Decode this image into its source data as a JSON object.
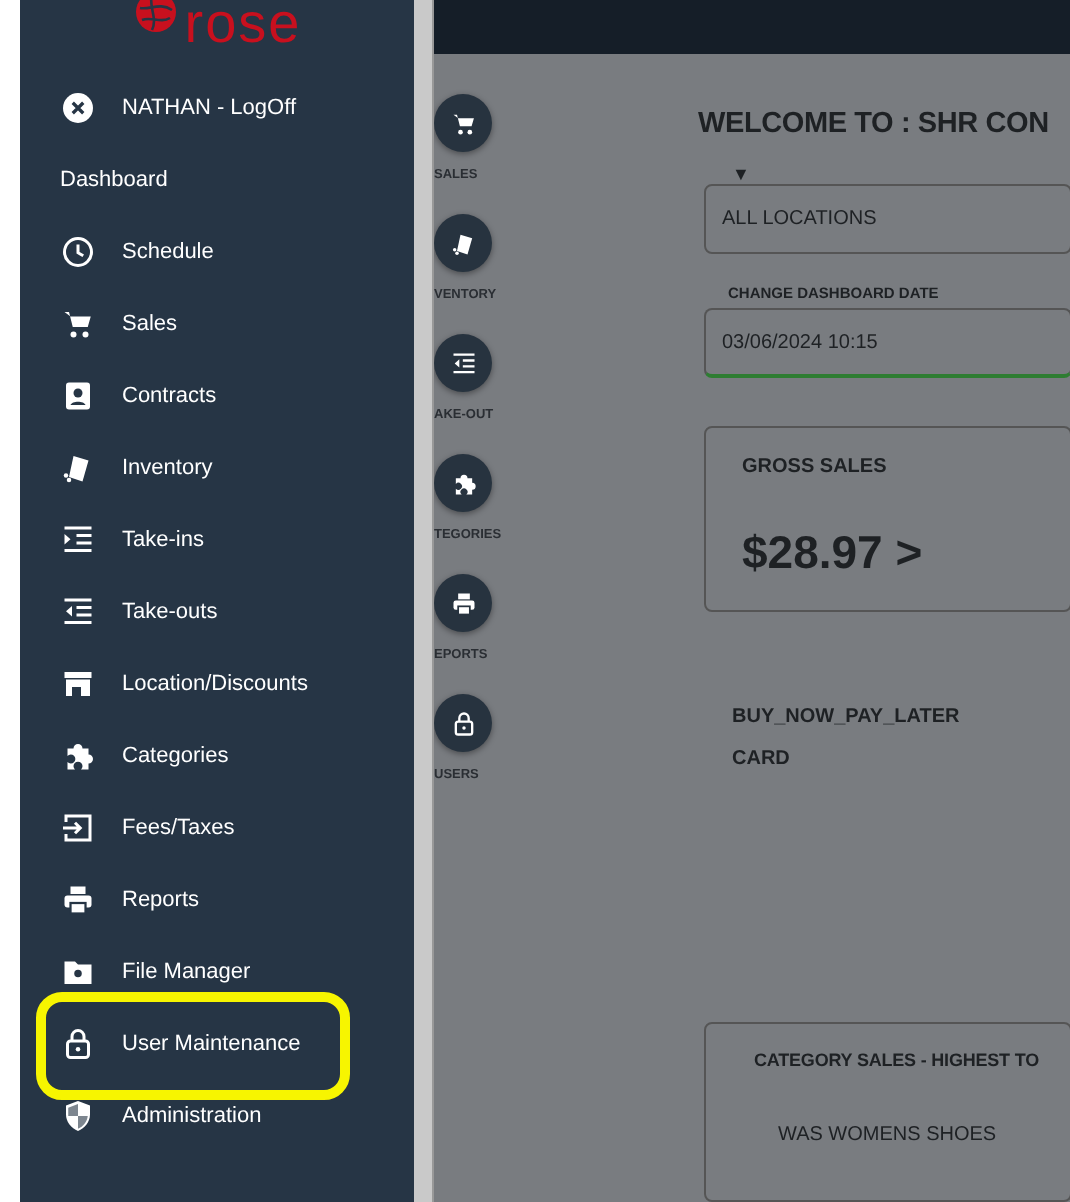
{
  "sidebar": {
    "logo": "rose",
    "items": [
      {
        "label": "NATHAN - LogOff",
        "kind": "entry",
        "highlighted": false
      },
      {
        "label": "Dashboard",
        "kind": "heading",
        "highlighted": false
      },
      {
        "label": "Schedule",
        "kind": "entry",
        "highlighted": false
      },
      {
        "label": "Sales",
        "kind": "entry",
        "highlighted": false
      },
      {
        "label": "Contracts",
        "kind": "entry",
        "highlighted": false
      },
      {
        "label": "Inventory",
        "kind": "entry",
        "highlighted": false
      },
      {
        "label": "Take-ins",
        "kind": "entry",
        "highlighted": false
      },
      {
        "label": "Take-outs",
        "kind": "entry",
        "highlighted": false
      },
      {
        "label": "Location/Discounts",
        "kind": "entry",
        "highlighted": false
      },
      {
        "label": "Categories",
        "kind": "entry",
        "highlighted": false
      },
      {
        "label": "Fees/Taxes",
        "kind": "entry",
        "highlighted": false
      },
      {
        "label": "Reports",
        "kind": "entry",
        "highlighted": false
      },
      {
        "label": "File Manager",
        "kind": "entry",
        "highlighted": false
      },
      {
        "label": "User Maintenance",
        "kind": "entry",
        "highlighted": true
      },
      {
        "label": "Administration",
        "kind": "entry",
        "highlighted": false
      }
    ]
  },
  "shortcuts": [
    {
      "label": "SALES"
    },
    {
      "label": "VENTORY"
    },
    {
      "label": "AKE-OUT"
    },
    {
      "label": "TEGORIES"
    },
    {
      "label": "EPORTS"
    },
    {
      "label": "USERS"
    }
  ],
  "dashboard": {
    "title": "WELCOME TO : SHR CON",
    "location_caret": "▼",
    "location": "ALL LOCATIONS",
    "date_label": "CHANGE DASHBOARD DATE",
    "date": "03/06/2024 10:15",
    "gross_sales": {
      "title": "GROSS SALES",
      "amount": "$28.97 >"
    },
    "payment_types": [
      "BUY_NOW_PAY_LATER",
      "CARD"
    ],
    "category_sales": {
      "title": "CATEGORY SALES - HIGHEST TO",
      "rows": [
        "WAS WOMENS SHOES"
      ]
    }
  }
}
